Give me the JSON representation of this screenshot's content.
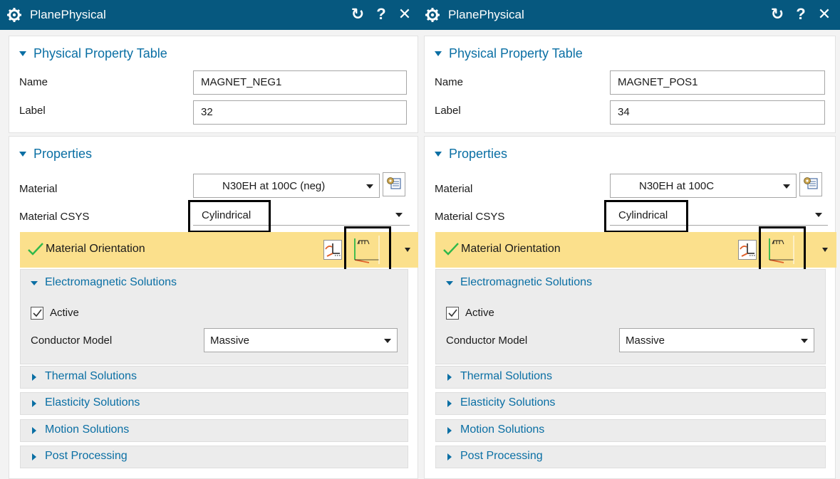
{
  "dialogs": [
    {
      "title": "PlanePhysical",
      "buttons": {
        "reset": "↻",
        "help": "?",
        "close": "✕"
      },
      "ppt": {
        "header": "Physical Property Table",
        "name_label": "Name",
        "name_value": "MAGNET_NEG1",
        "label_label": "Label",
        "label_value": "32"
      },
      "props": {
        "header": "Properties",
        "material_label": "Material",
        "material_value": "N30EH at 100C (neg)",
        "csys_label": "Material CSYS",
        "csys_value": "Cylindrical",
        "orientation_label": "Material Orientation",
        "em": {
          "header": "Electromagnetic Solutions",
          "active_label": "Active",
          "active_checked": true,
          "conductor_label": "Conductor Model",
          "conductor_value": "Massive"
        },
        "thermal": "Thermal Solutions",
        "elasticity": "Elasticity Solutions",
        "motion": "Motion Solutions",
        "post": "Post Processing"
      },
      "icons": {
        "title": "gear-icon",
        "material": "material-library-icon",
        "orient_1": "csys-dialog-icon",
        "orient_2": "csys-inferred-icon"
      }
    },
    {
      "title": "PlanePhysical",
      "buttons": {
        "reset": "↻",
        "help": "?",
        "close": "✕"
      },
      "ppt": {
        "header": "Physical Property Table",
        "name_label": "Name",
        "name_value": "MAGNET_POS1",
        "label_label": "Label",
        "label_value": "34"
      },
      "props": {
        "header": "Properties",
        "material_label": "Material",
        "material_value": "N30EH at 100C",
        "csys_label": "Material CSYS",
        "csys_value": "Cylindrical",
        "orientation_label": "Material Orientation",
        "em": {
          "header": "Electromagnetic Solutions",
          "active_label": "Active",
          "active_checked": true,
          "conductor_label": "Conductor Model",
          "conductor_value": "Massive"
        },
        "thermal": "Thermal Solutions",
        "elasticity": "Elasticity Solutions",
        "motion": "Motion Solutions",
        "post": "Post Processing"
      },
      "icons": {
        "title": "gear-icon",
        "material": "material-library-icon",
        "orient_1": "csys-dialog-icon",
        "orient_2": "csys-inferred-icon"
      }
    }
  ],
  "colors": {
    "titlebar": "#06587f",
    "section_header": "#0a6fa4",
    "orientation_highlight": "#fbe08c",
    "check_green": "#2fb84a"
  }
}
